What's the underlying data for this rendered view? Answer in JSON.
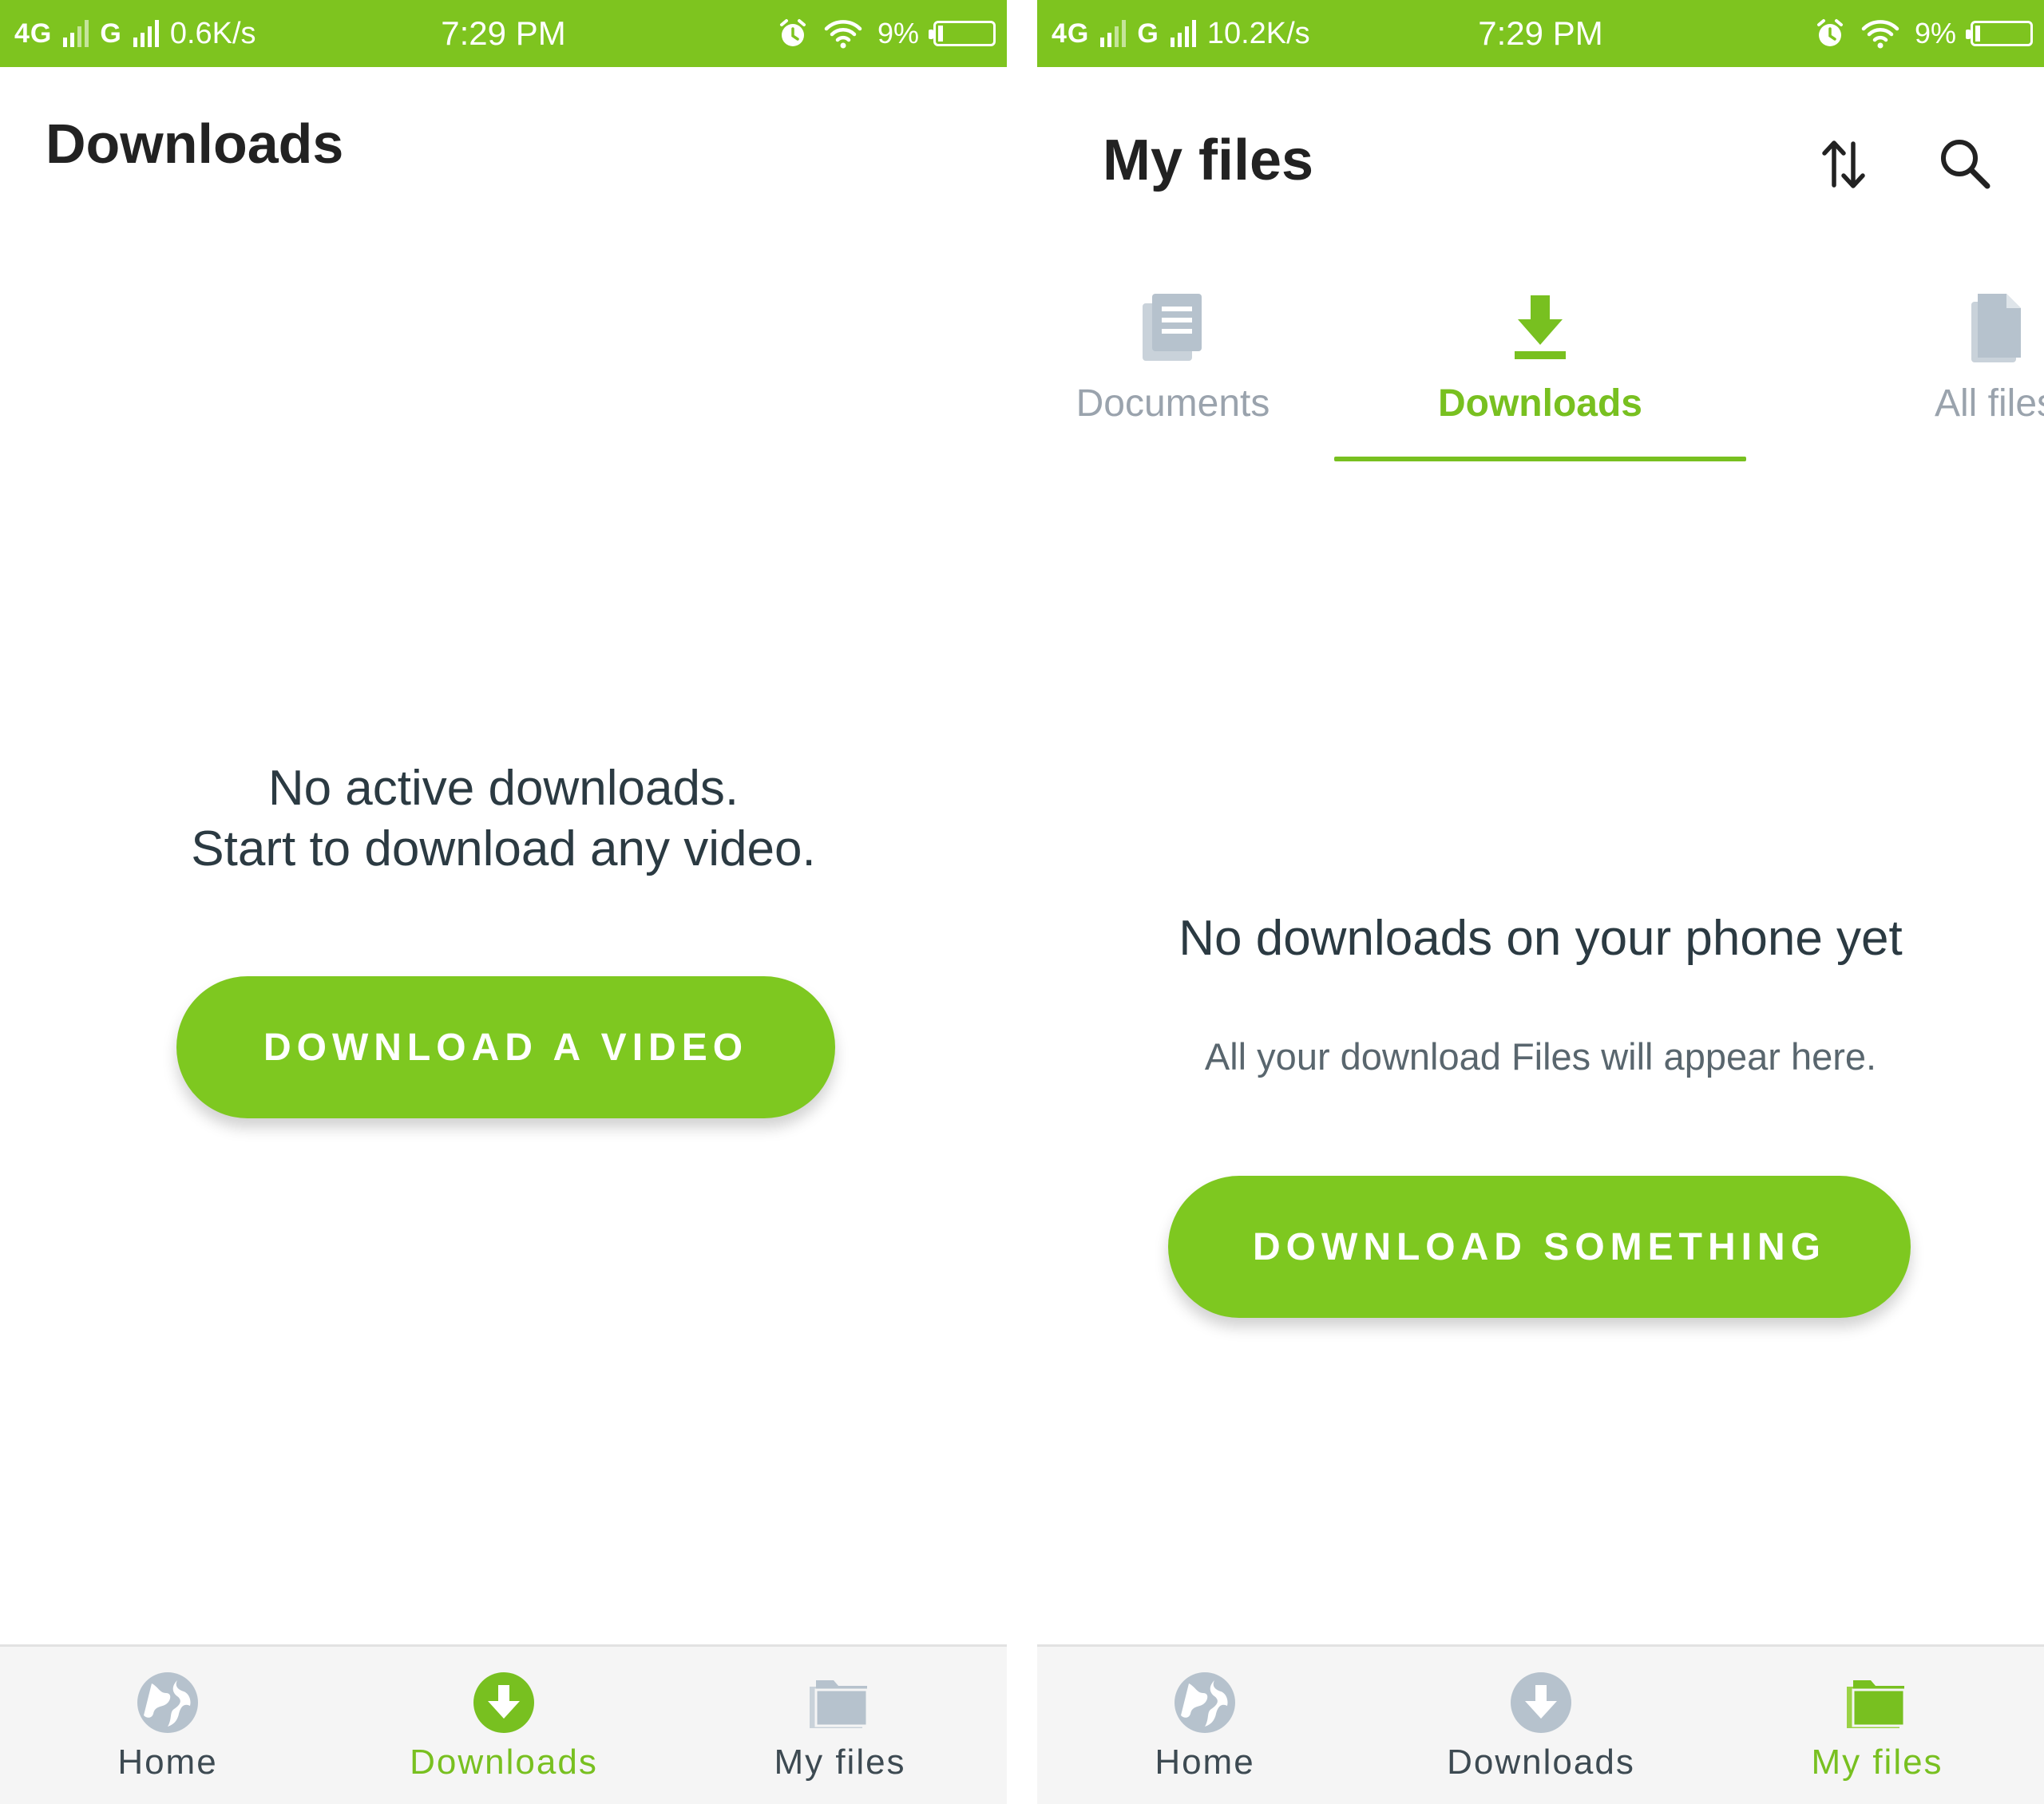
{
  "colors": {
    "accent": "#7ec41f",
    "button": "#7ec820",
    "inactive_icon": "#b6c2cd",
    "text_dark": "#2b3a42"
  },
  "left_screen": {
    "status_bar": {
      "network": "4G",
      "network2": "G",
      "speed": "0.6K/s",
      "time": "7:29 PM",
      "battery": "9%",
      "battery_level": 0.09
    },
    "title": "Downloads",
    "empty_line1": "No active downloads.",
    "empty_line2": "Start to download any video.",
    "cta_label": "DOWNLOAD A VIDEO",
    "nav": {
      "home": "Home",
      "downloads": "Downloads",
      "files": "My files",
      "active": "downloads"
    }
  },
  "right_screen": {
    "status_bar": {
      "network": "4G",
      "network2": "G",
      "speed": "10.2K/s",
      "time": "7:29 PM",
      "battery": "9%",
      "battery_level": 0.09
    },
    "title": "My files",
    "icons": {
      "sort": "sort-arrows-icon",
      "search": "search-icon"
    },
    "tabs": [
      {
        "label": "Documents",
        "icon": "documents-icon"
      },
      {
        "label": "Downloads",
        "icon": "download-arrow-icon",
        "active": true
      },
      {
        "label": "All files",
        "icon": "file-icon"
      }
    ],
    "empty_title": "No downloads on your phone yet",
    "empty_subtitle": "All your download Files will appear here.",
    "cta_label": "DOWNLOAD SOMETHING",
    "nav": {
      "home": "Home",
      "downloads": "Downloads",
      "files": "My files",
      "active": "files"
    }
  }
}
